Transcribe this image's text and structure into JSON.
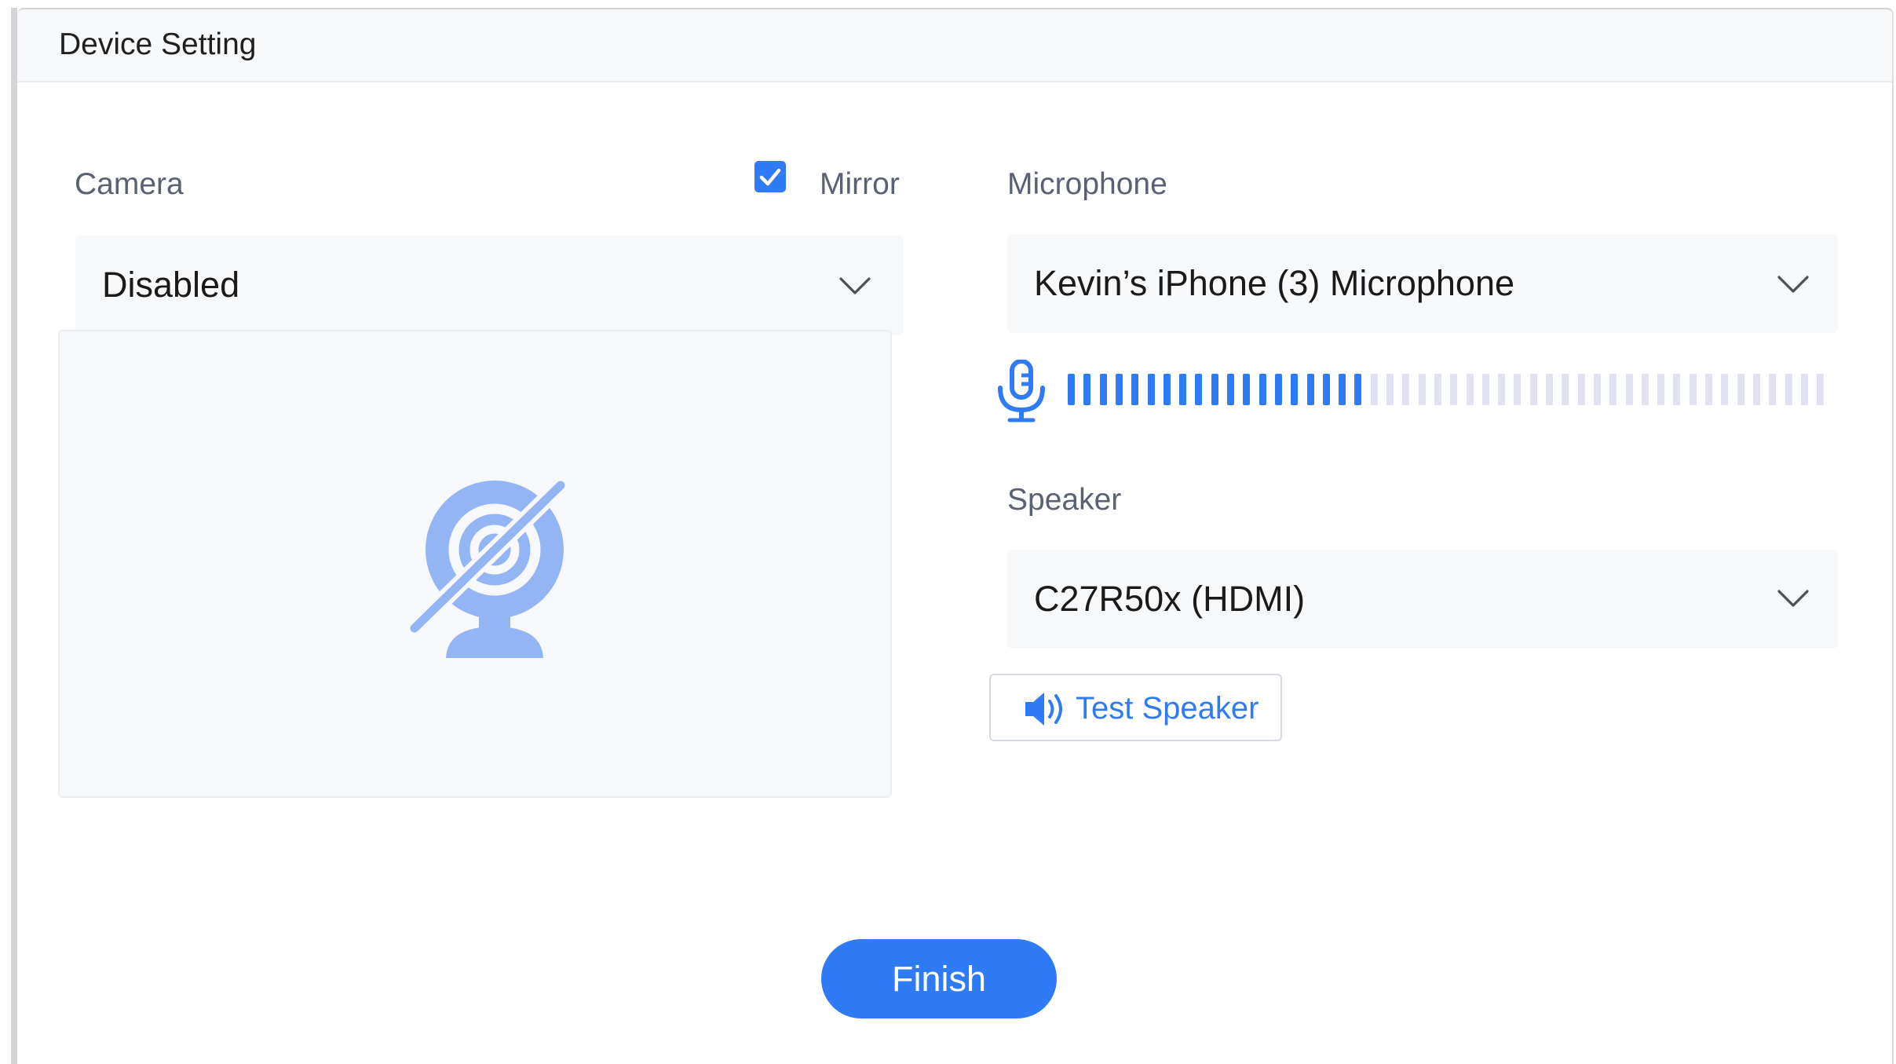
{
  "window": {
    "title": "Device Setting"
  },
  "camera": {
    "label": "Camera",
    "mirror_label": "Mirror",
    "mirror_checked": true,
    "selected": "Disabled",
    "preview_icon": "camera-off-icon"
  },
  "microphone": {
    "label": "Microphone",
    "selected": "Kevin’s iPhone (3) Microphone",
    "level_icon": "microphone-icon",
    "level_fraction": 0.39
  },
  "speaker": {
    "label": "Speaker",
    "selected": "C27R50x (HDMI)",
    "test_label": "Test Speaker",
    "test_icon": "speaker-icon"
  },
  "actions": {
    "finish_label": "Finish"
  },
  "colors": {
    "accent": "#2f7bf5",
    "meter_inactive": "#e0e3ef",
    "camera_icon": "#93b5f4"
  }
}
